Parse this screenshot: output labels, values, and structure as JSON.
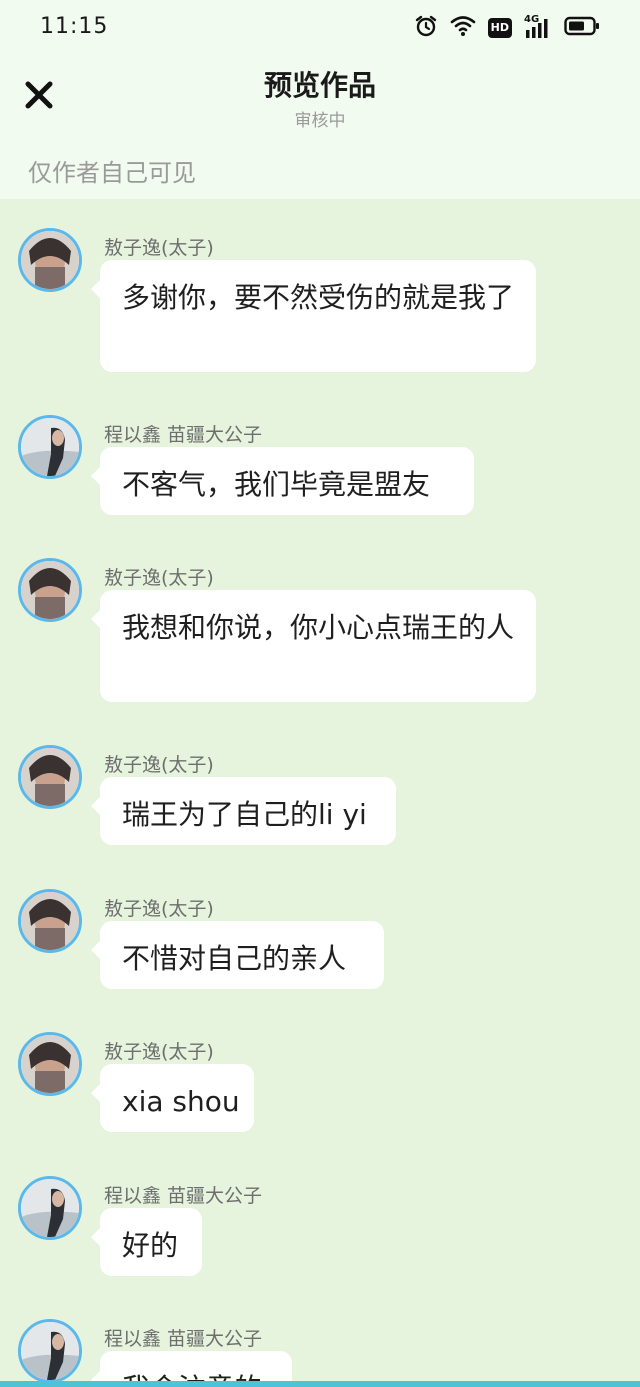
{
  "status_bar": {
    "time": "11:15",
    "icons": [
      "alarm-icon",
      "wifi-icon",
      "hd-icon",
      "signal-4g-icon",
      "battery-icon"
    ],
    "hd_label": "HD",
    "network_label": "4G"
  },
  "header": {
    "title": "预览作品",
    "subtitle": "审核中",
    "close_icon": "close-icon"
  },
  "visibility_note": "仅作者自己可见",
  "characters": {
    "a": "敖子逸(太子)",
    "b": "程以鑫 苗疆大公子"
  },
  "messages": [
    {
      "sender": "敖子逸(太子)",
      "avatar": "a",
      "text": "多谢你，要不然受伤的就是我了"
    },
    {
      "sender": "程以鑫 苗疆大公子",
      "avatar": "b",
      "text": "不客气，我们毕竟是盟友"
    },
    {
      "sender": "敖子逸(太子)",
      "avatar": "a",
      "text": "我想和你说，你小心点瑞王的人"
    },
    {
      "sender": "敖子逸(太子)",
      "avatar": "a",
      "text": "瑞王为了自己的li yi"
    },
    {
      "sender": "敖子逸(太子)",
      "avatar": "a",
      "text": "不惜对自己的亲人"
    },
    {
      "sender": "敖子逸(太子)",
      "avatar": "a",
      "text": "xia shou"
    },
    {
      "sender": "程以鑫 苗疆大公子",
      "avatar": "b",
      "text": "好的"
    },
    {
      "sender": "程以鑫 苗疆大公子",
      "avatar": "b",
      "text": "我会注意的"
    }
  ],
  "colors": {
    "background": "#e6f4dd",
    "header_bg": "#f2fbef",
    "bubble": "#ffffff",
    "avatar_ring": "#5bb8ea",
    "bottom_accent": "#4ec3d8"
  }
}
